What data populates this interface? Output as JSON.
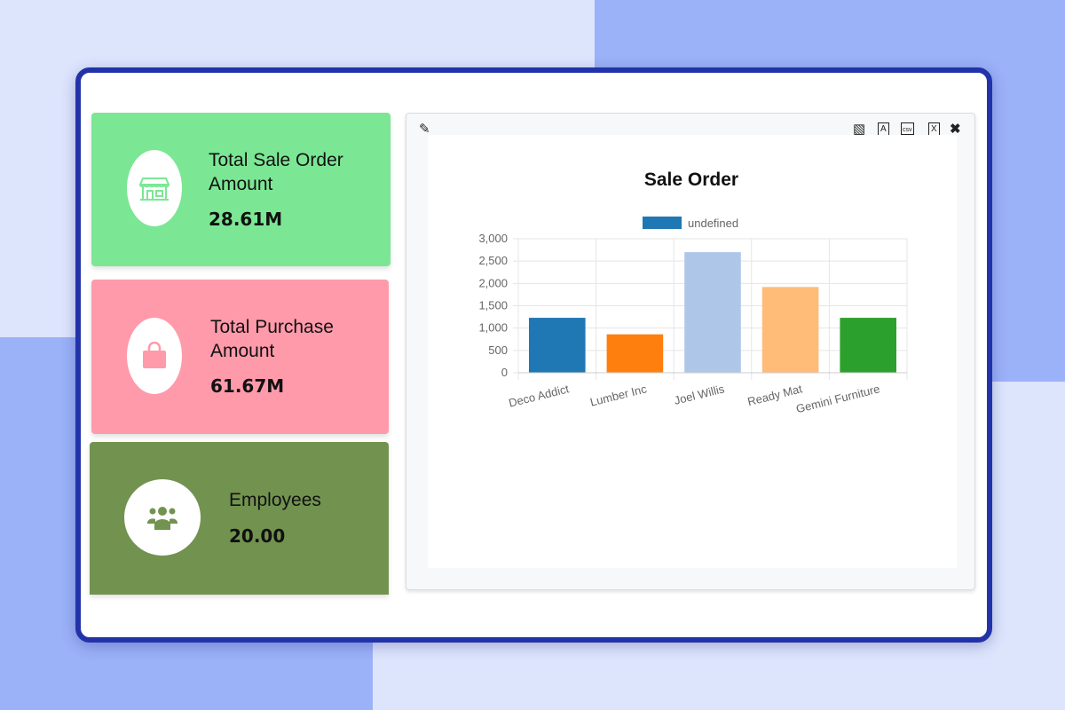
{
  "cards": [
    {
      "title_line1": "Total Sale Order",
      "title_line2": "Amount",
      "value": "28.61M",
      "icon": "store-icon",
      "color": "#7be794"
    },
    {
      "title_line1": "Total Purchase",
      "title_line2": "Amount",
      "value": "61.67M",
      "icon": "shopping-bag-icon",
      "color": "#ff9aab"
    },
    {
      "title_line1": "Employees",
      "title_line2": "",
      "value": "20.00",
      "icon": "users-icon",
      "color": "#729350"
    }
  ],
  "toolbar": {
    "icons": [
      "pencil-icon",
      "image-icon",
      "pdf-icon",
      "csv-icon",
      "excel-icon",
      "close-icon"
    ]
  },
  "chart_data": {
    "type": "bar",
    "title": "Sale Order",
    "legend": {
      "label": "undefined",
      "position": "top"
    },
    "categories": [
      "Deco Addict",
      "Lumber Inc",
      "Joel Willis",
      "Ready Mat",
      "Gemini Furniture"
    ],
    "values": [
      1230,
      860,
      2700,
      1920,
      1230
    ],
    "colors": [
      "#1f77b4",
      "#ff7f0e",
      "#aec7e8",
      "#ffbb78",
      "#2ca02c"
    ],
    "ylim": [
      0,
      3000
    ],
    "yticks": [
      "0",
      "500",
      "1,000",
      "1,500",
      "2,000",
      "2,500",
      "3,000"
    ],
    "grid": true
  }
}
